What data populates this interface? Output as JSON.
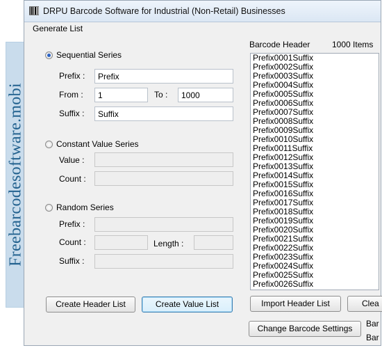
{
  "watermark": "Freebarcodesoftware.mobi",
  "window": {
    "title": "DRPU Barcode Software for Industrial (Non-Retail) Businesses"
  },
  "group": {
    "title": "Generate List"
  },
  "sequential": {
    "label": "Sequential Series",
    "selected": true,
    "prefix_label": "Prefix :",
    "prefix_value": "Prefix",
    "from_label": "From :",
    "from_value": "1",
    "to_label": "To :",
    "to_value": "1000",
    "suffix_label": "Suffix :",
    "suffix_value": "Suffix"
  },
  "constant": {
    "label": "Constant Value Series",
    "selected": false,
    "value_label": "Value :",
    "count_label": "Count :"
  },
  "random": {
    "label": "Random Series",
    "selected": false,
    "prefix_label": "Prefix :",
    "count_label": "Count :",
    "length_label": "Length :",
    "suffix_label": "Suffix :"
  },
  "list": {
    "header_label": "Barcode Header",
    "count_label": "1000 Items",
    "items": [
      "Prefix0001Suffix",
      "Prefix0002Suffix",
      "Prefix0003Suffix",
      "Prefix0004Suffix",
      "Prefix0005Suffix",
      "Prefix0006Suffix",
      "Prefix0007Suffix",
      "Prefix0008Suffix",
      "Prefix0009Suffix",
      "Prefix0010Suffix",
      "Prefix0011Suffix",
      "Prefix0012Suffix",
      "Prefix0013Suffix",
      "Prefix0014Suffix",
      "Prefix0015Suffix",
      "Prefix0016Suffix",
      "Prefix0017Suffix",
      "Prefix0018Suffix",
      "Prefix0019Suffix",
      "Prefix0020Suffix",
      "Prefix0021Suffix",
      "Prefix0022Suffix",
      "Prefix0023Suffix",
      "Prefix0024Suffix",
      "Prefix0025Suffix",
      "Prefix0026Suffix"
    ]
  },
  "buttons": {
    "create_header": "Create Header List",
    "create_value": "Create Value List",
    "import_header": "Import Header List",
    "clear": "Clea",
    "change_settings": "Change Barcode Settings"
  },
  "side_labels": [
    "Bar",
    "Bar"
  ]
}
